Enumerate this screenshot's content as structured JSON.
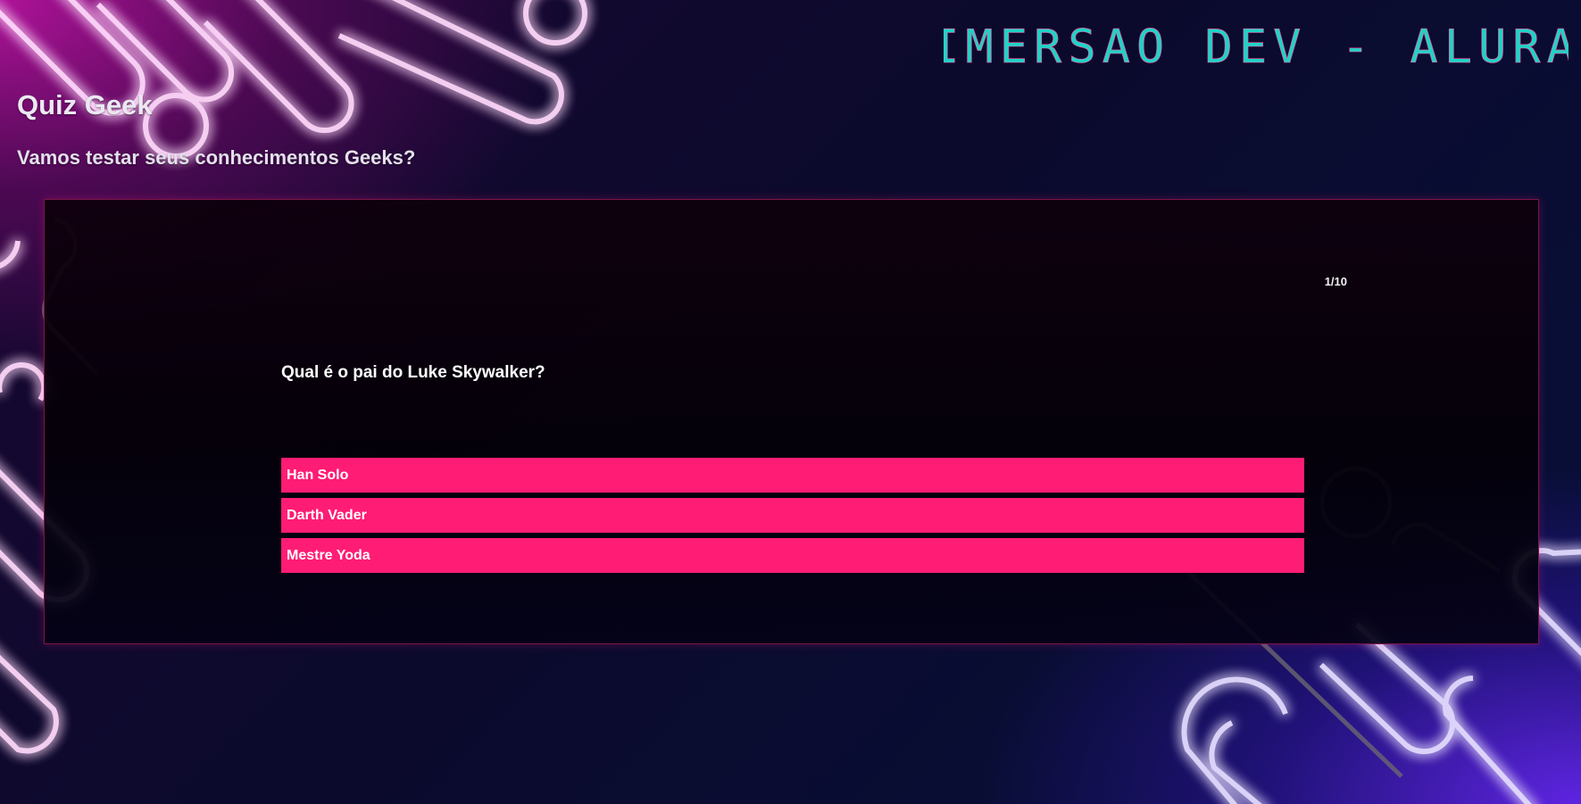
{
  "header": {
    "brand": "IMERSAO DEV - ALURA",
    "title": "Quiz Geek",
    "subtitle": "Vamos testar seus conhecimentos Geeks?"
  },
  "quiz": {
    "counter": "1/10",
    "question": "Qual é o pai do Luke Skywalker?",
    "answers": [
      {
        "label": "Han Solo"
      },
      {
        "label": "Darth Vader"
      },
      {
        "label": "Mestre Yoda"
      }
    ]
  },
  "theme": {
    "answer_button_color": "#ff1c74",
    "logo_color": "#1fd3c7",
    "logo_accent_color": "#ff4fa0",
    "neon_pink": "#ff5be6",
    "neon_violet": "#b8a6ff"
  }
}
